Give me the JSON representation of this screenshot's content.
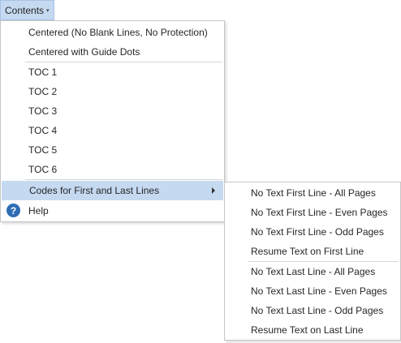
{
  "menubar": {
    "title": "Contents",
    "caret": "▾"
  },
  "main_menu": {
    "items": [
      {
        "label": "Centered (No Blank Lines, No Protection)"
      },
      {
        "label": "Centered with Guide Dots"
      },
      {
        "label": "TOC 1"
      },
      {
        "label": "TOC 2"
      },
      {
        "label": "TOC 3"
      },
      {
        "label": "TOC 4"
      },
      {
        "label": "TOC 5"
      },
      {
        "label": "TOC 6"
      },
      {
        "label": "Codes for First and Last Lines"
      },
      {
        "label": "Help",
        "icon_glyph": "?"
      }
    ]
  },
  "sub_menu": {
    "items": [
      {
        "label": "No Text First Line - All Pages"
      },
      {
        "label": "No Text First Line - Even Pages"
      },
      {
        "label": "No Text First Line - Odd Pages"
      },
      {
        "label": "Resume Text on First Line"
      },
      {
        "label": "No Text Last Line - All Pages"
      },
      {
        "label": "No Text Last Line - Even Pages"
      },
      {
        "label": "No Text Last Line - Odd Pages"
      },
      {
        "label": "Resume Text on Last Line"
      }
    ]
  },
  "colors": {
    "highlight": "#c5d9f1",
    "help_icon": "#2e6db5"
  }
}
